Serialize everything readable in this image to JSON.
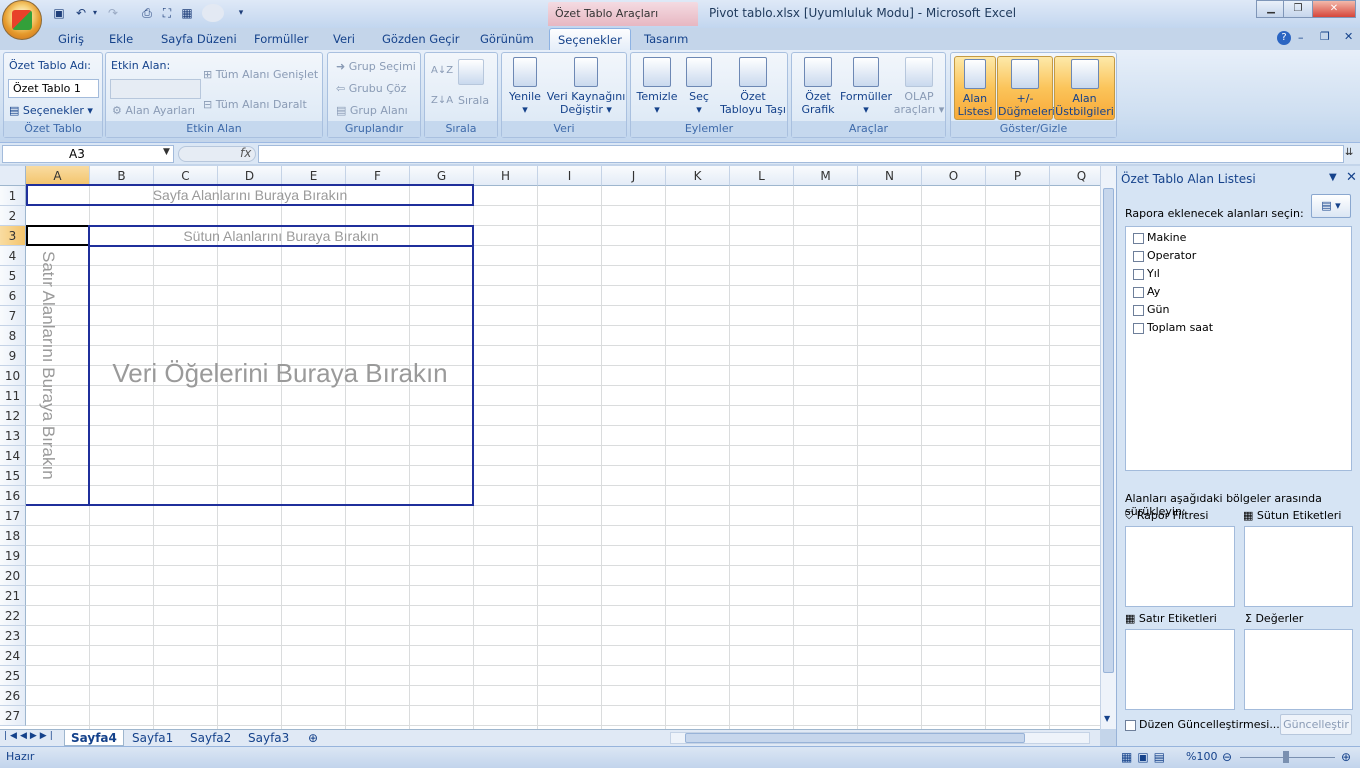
{
  "window": {
    "title": "Pivot tablo.xlsx  [Uyumluluk Modu] - Microsoft Excel",
    "context_tab": "Özet Tablo Araçları"
  },
  "ribbon_tabs": [
    "Giriş",
    "Ekle",
    "Sayfa Düzeni",
    "Formüller",
    "Veri",
    "Gözden Geçir",
    "Görünüm",
    "Seçenekler",
    "Tasarım"
  ],
  "groups": {
    "ozet_tablo": {
      "label": "Özet Tablo",
      "name_label": "Özet Tablo Adı:",
      "name_value": "Özet Tablo 1",
      "options_btn": "Seçenekler"
    },
    "etkin_alan": {
      "label": "Etkin Alan",
      "field_label": "Etkin Alan:",
      "settings_btn": "Alan Ayarları",
      "expand_btn": "Tüm Alanı Genişlet",
      "collapse_btn": "Tüm Alanı Daralt"
    },
    "gruplandir": {
      "label": "Gruplandır",
      "group_sel": "Grup Seçimi",
      "ungroup": "Grubu Çöz",
      "group_field": "Grup Alanı"
    },
    "sirala": {
      "label": "Sırala",
      "sort": "Sırala"
    },
    "veri": {
      "label": "Veri",
      "refresh": "Yenile",
      "change_source_1": "Veri Kaynağını",
      "change_source_2": "Değiştir"
    },
    "eylemler": {
      "label": "Eylemler",
      "clear": "Temizle",
      "select": "Seç",
      "move_1": "Özet",
      "move_2": "Tabloyu Taşı"
    },
    "araclar": {
      "label": "Araçlar",
      "chart_1": "Özet",
      "chart_2": "Grafik",
      "formulas": "Formüller",
      "olap_1": "OLAP",
      "olap_2": "araçları"
    },
    "goster": {
      "label": "Göster/Gizle",
      "field_list_1": "Alan",
      "field_list_2": "Listesi",
      "buttons_1": "+/-",
      "buttons_2": "Düğmeleri",
      "headers_1": "Alan",
      "headers_2": "Üstbilgileri"
    }
  },
  "formula_bar": {
    "name_box": "A3",
    "fx": "fx",
    "formula": ""
  },
  "columns": [
    "A",
    "B",
    "C",
    "D",
    "E",
    "F",
    "G",
    "H",
    "I",
    "J",
    "K",
    "L",
    "M",
    "N",
    "O",
    "P",
    "Q"
  ],
  "rows": [
    "1",
    "2",
    "3",
    "4",
    "5",
    "6",
    "7",
    "8",
    "9",
    "10",
    "11",
    "12",
    "13",
    "14",
    "15",
    "16",
    "17",
    "18",
    "19",
    "20",
    "21",
    "22",
    "23",
    "24",
    "25",
    "26",
    "27"
  ],
  "pivot": {
    "page_drop": "Sayfa Alanlarını Buraya Bırakın",
    "col_drop": "Sütun Alanlarını Buraya Bırakın",
    "row_drop": "Satır Alanlarını Buraya Bırakın",
    "data_drop": "Veri Öğelerini Buraya Bırakın"
  },
  "sheets": {
    "tabs": [
      "Sayfa4",
      "Sayfa1",
      "Sayfa2",
      "Sayfa3"
    ],
    "active": "Sayfa4"
  },
  "status": {
    "ready": "Hazır",
    "zoom": "%100"
  },
  "field_pane": {
    "title": "Özet Tablo Alan Listesi",
    "choose": "Rapora eklenecek alanları seçin:",
    "fields": [
      "Makine",
      "Operator",
      "Yıl",
      "Ay",
      "Gün",
      "Toplam saat"
    ],
    "drag_hint": "Alanları aşağıdaki bölgeler arasında sürükleyin:",
    "report_filter": "Rapor Filtresi",
    "col_labels": "Sütun Etiketleri",
    "row_labels": "Satır Etiketleri",
    "values": "Değerler",
    "defer": "Düzen Güncelleştirmesi...",
    "update_btn": "Güncelleştir"
  }
}
